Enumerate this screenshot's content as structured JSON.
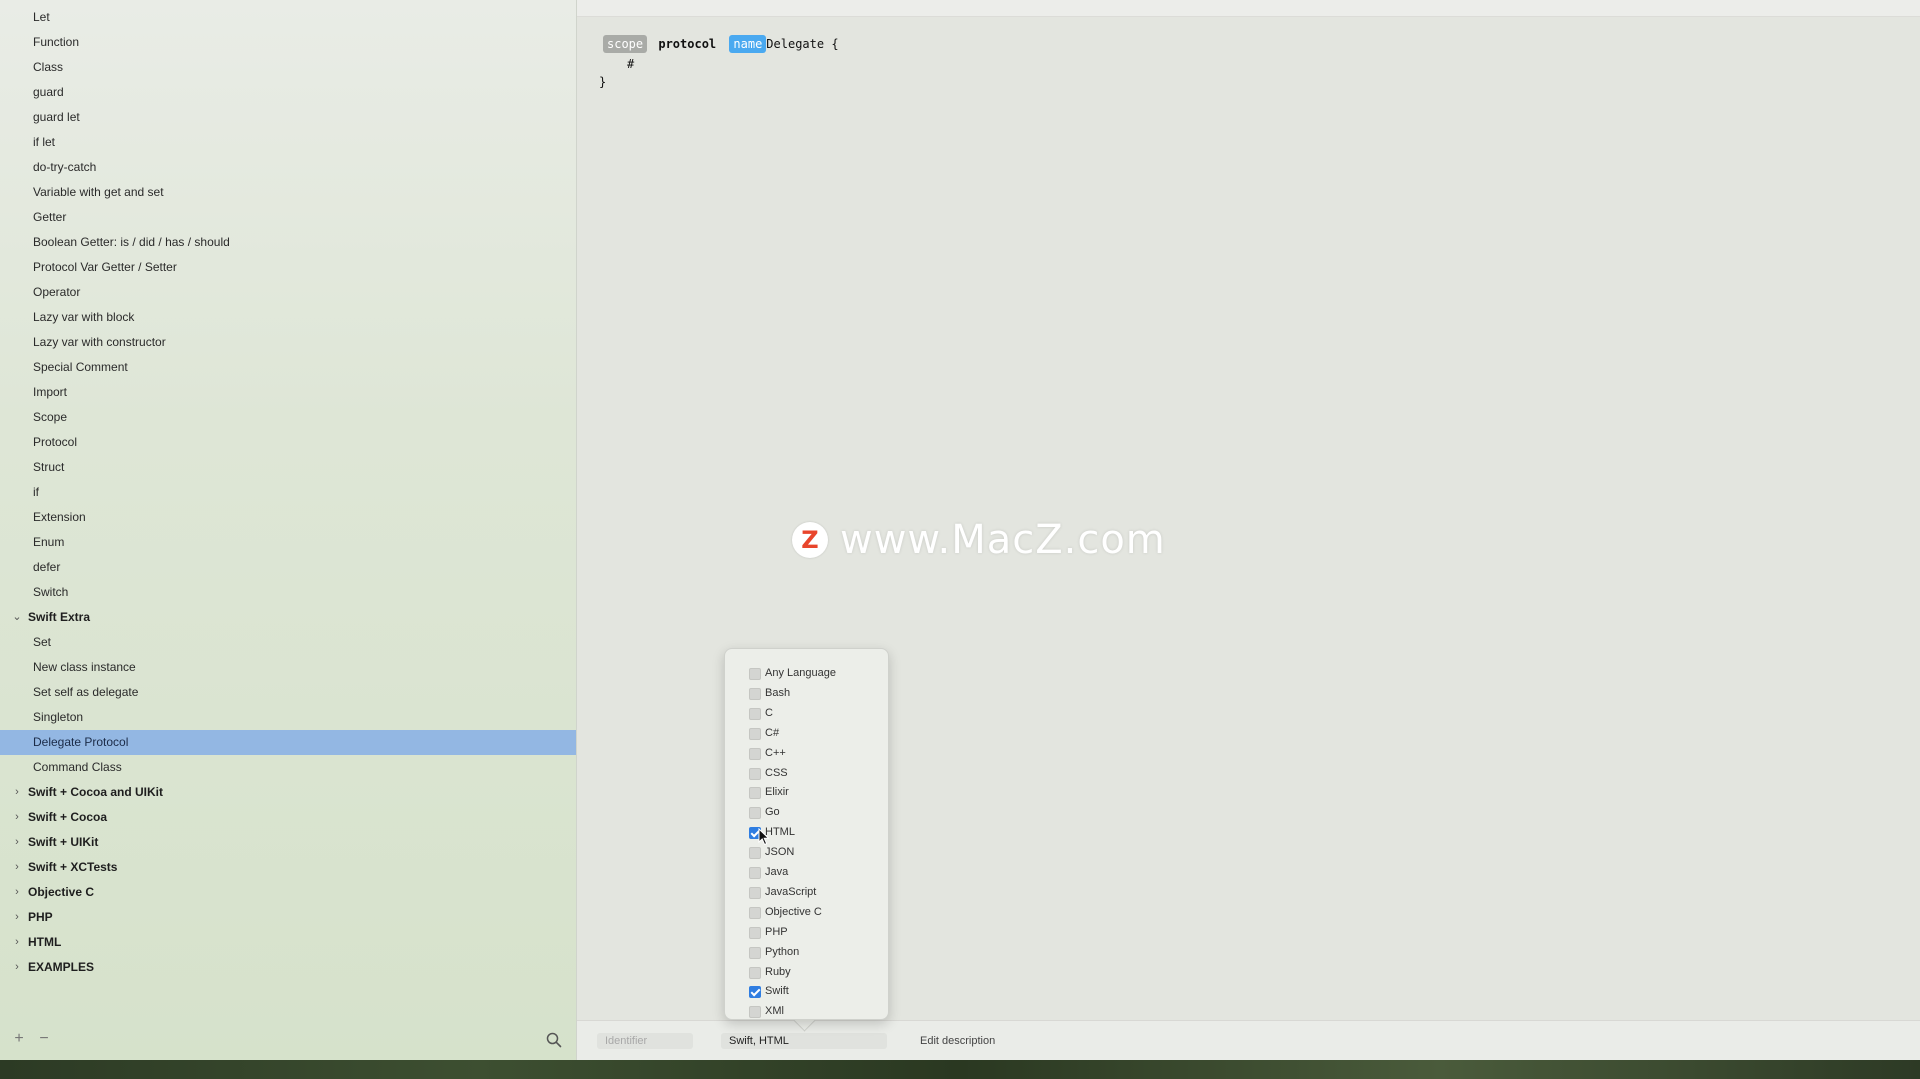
{
  "sidebar": {
    "items": [
      {
        "label": "Let",
        "type": "item"
      },
      {
        "label": "Function",
        "type": "item"
      },
      {
        "label": "Class",
        "type": "item"
      },
      {
        "label": "guard",
        "type": "item"
      },
      {
        "label": "guard let",
        "type": "item"
      },
      {
        "label": "if let",
        "type": "item"
      },
      {
        "label": "do-try-catch",
        "type": "item"
      },
      {
        "label": "Variable with get and set",
        "type": "item"
      },
      {
        "label": "Getter",
        "type": "item"
      },
      {
        "label": "Boolean Getter: is / did / has / should",
        "type": "item"
      },
      {
        "label": "Protocol Var Getter / Setter",
        "type": "item"
      },
      {
        "label": "Operator",
        "type": "item"
      },
      {
        "label": "Lazy var with block",
        "type": "item"
      },
      {
        "label": "Lazy var with constructor",
        "type": "item"
      },
      {
        "label": "Special Comment",
        "type": "item"
      },
      {
        "label": "Import",
        "type": "item"
      },
      {
        "label": "Scope",
        "type": "item"
      },
      {
        "label": "Protocol",
        "type": "item"
      },
      {
        "label": "Struct",
        "type": "item"
      },
      {
        "label": "if",
        "type": "item"
      },
      {
        "label": "Extension",
        "type": "item"
      },
      {
        "label": "Enum",
        "type": "item"
      },
      {
        "label": "defer",
        "type": "item"
      },
      {
        "label": "Switch",
        "type": "item"
      },
      {
        "label": "Swift Extra",
        "type": "group",
        "expanded": true
      },
      {
        "label": "Set",
        "type": "item"
      },
      {
        "label": "New class instance",
        "type": "item"
      },
      {
        "label": "Set self as delegate",
        "type": "item"
      },
      {
        "label": "Singleton",
        "type": "item"
      },
      {
        "label": "Delegate Protocol",
        "type": "item",
        "selected": true
      },
      {
        "label": "Command Class",
        "type": "item"
      },
      {
        "label": "Swift + Cocoa and UIKit",
        "type": "group",
        "expanded": false
      },
      {
        "label": "Swift + Cocoa",
        "type": "group",
        "expanded": false
      },
      {
        "label": "Swift + UIKit",
        "type": "group",
        "expanded": false
      },
      {
        "label": "Swift + XCTests",
        "type": "group",
        "expanded": false
      },
      {
        "label": "Objective C",
        "type": "group",
        "expanded": false
      },
      {
        "label": "PHP",
        "type": "group",
        "expanded": false
      },
      {
        "label": "HTML",
        "type": "group",
        "expanded": false
      },
      {
        "label": "EXAMPLES",
        "type": "group",
        "expanded": false
      }
    ],
    "footer": {
      "add": "+",
      "remove": "−",
      "search_icon": "search-icon"
    }
  },
  "editor": {
    "code": {
      "token_scope": "scope",
      "keyword": "protocol",
      "token_name": "name",
      "suffix": "Delegate {",
      "line2": "#",
      "line3": "}"
    }
  },
  "watermark": {
    "logo_letter": "Z",
    "text": "www.MacZ.com"
  },
  "bottombar": {
    "identifier_placeholder": "Identifier",
    "languages_value": "Swift, HTML",
    "edit_description": "Edit description"
  },
  "languages_popover": {
    "options": [
      {
        "label": "Any Language",
        "checked": false
      },
      {
        "label": "Bash",
        "checked": false
      },
      {
        "label": "C",
        "checked": false
      },
      {
        "label": "C#",
        "checked": false
      },
      {
        "label": "C++",
        "checked": false
      },
      {
        "label": "CSS",
        "checked": false
      },
      {
        "label": "Elixir",
        "checked": false
      },
      {
        "label": "Go",
        "checked": false
      },
      {
        "label": "HTML",
        "checked": true
      },
      {
        "label": "JSON",
        "checked": false
      },
      {
        "label": "Java",
        "checked": false
      },
      {
        "label": "JavaScript",
        "checked": false
      },
      {
        "label": "Objective C",
        "checked": false
      },
      {
        "label": "PHP",
        "checked": false
      },
      {
        "label": "Python",
        "checked": false
      },
      {
        "label": "Ruby",
        "checked": false
      },
      {
        "label": "Swift",
        "checked": true
      },
      {
        "label": "XMl",
        "checked": false
      }
    ]
  },
  "colors": {
    "selection": "#93b7e3",
    "name_token": "#4aa9f0",
    "scope_token": "#a9aba7",
    "checkbox_on": "#2f7de1"
  }
}
